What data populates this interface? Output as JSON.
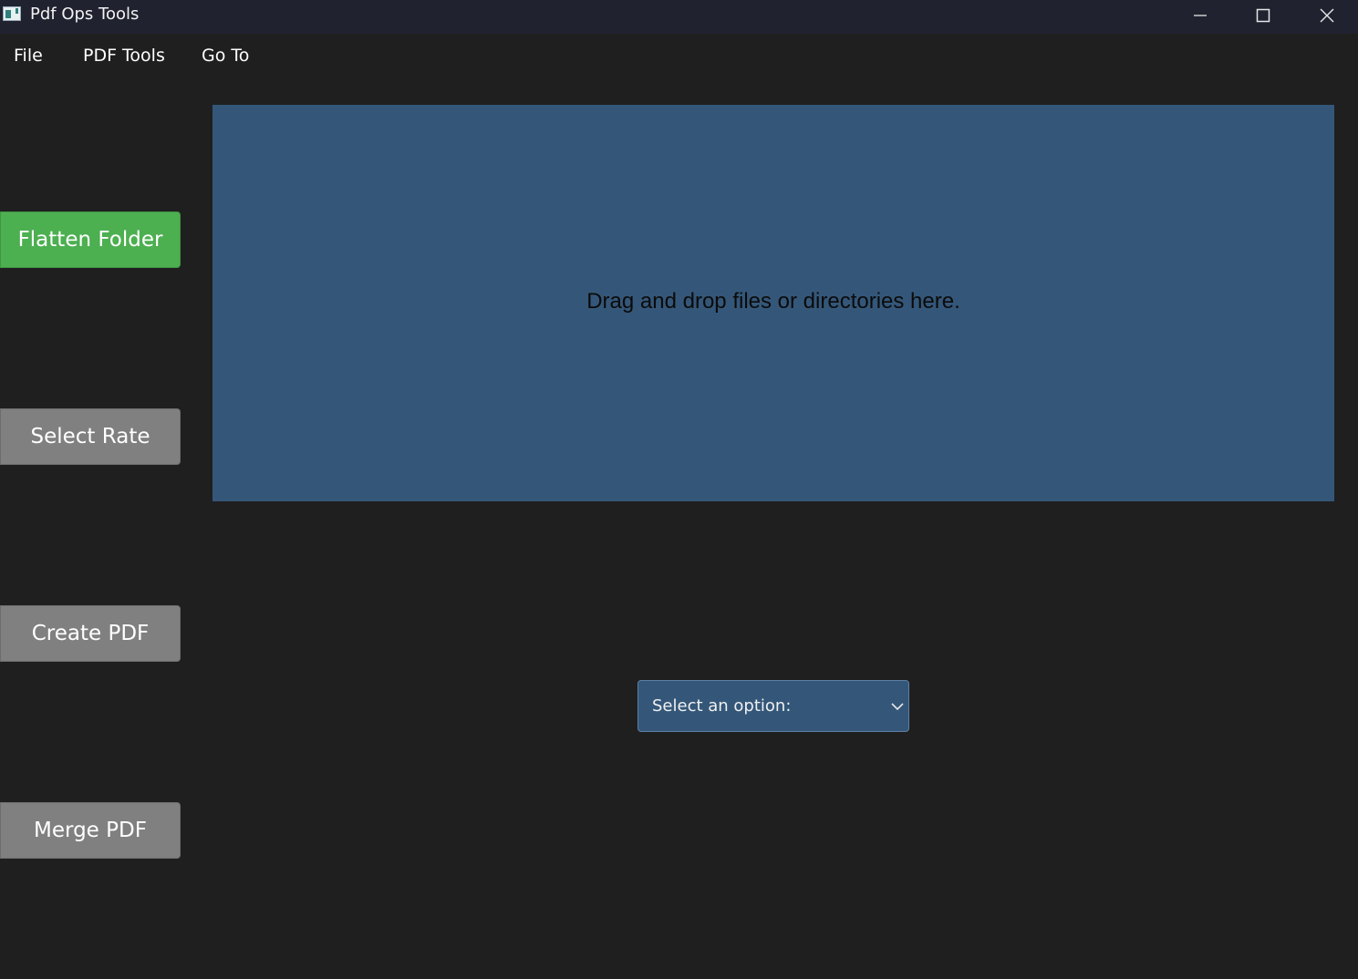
{
  "window": {
    "title": "Pdf Ops Tools",
    "icons": {
      "app": "app-icon",
      "minimize": "minimize-icon",
      "maximize": "maximize-icon",
      "close": "close-icon"
    }
  },
  "menu": {
    "items": [
      {
        "label": "File"
      },
      {
        "label": "PDF Tools"
      },
      {
        "label": "Go To"
      }
    ]
  },
  "sidebar": {
    "buttons": [
      {
        "label": "Flatten Folder",
        "color": "#4caf50",
        "active": true
      },
      {
        "label": "Select Rate",
        "color": "#808080",
        "active": false
      },
      {
        "label": "Create PDF",
        "color": "#808080",
        "active": false
      },
      {
        "label": "Merge PDF",
        "color": "#808080",
        "active": false
      }
    ]
  },
  "dropzone": {
    "text": "Drag and drop files or directories here.",
    "background": "#345779"
  },
  "select": {
    "value": "Select an option:",
    "icon": "chevron-down-icon"
  },
  "colors": {
    "titlebar": "#202230",
    "background": "#1f1f1f",
    "accent_green": "#4caf50",
    "button_gray": "#808080",
    "panel_blue": "#345779"
  }
}
